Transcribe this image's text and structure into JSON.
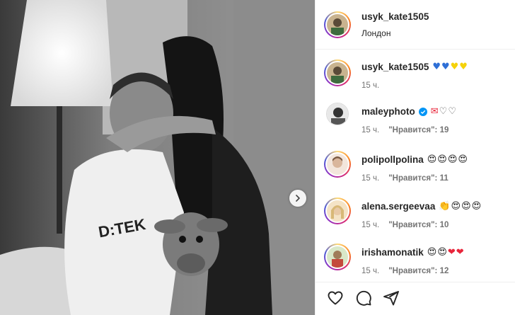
{
  "post": {
    "author": "usyk_kate1505",
    "location": "Лондон"
  },
  "comments": [
    {
      "user": "usyk_kate1505",
      "text": "💙💙💛💛",
      "time": "15 ч.",
      "likes": "",
      "verified": false
    },
    {
      "user": "maleyphoto",
      "text": "💌♡♡",
      "time": "15 ч.",
      "likes": "\"Нравится\": 19",
      "verified": true
    },
    {
      "user": "polipollpolina",
      "text": "😍😍😍😍",
      "time": "15 ч.",
      "likes": "\"Нравится\": 11",
      "verified": false
    },
    {
      "user": "alena.sergeevaa",
      "text": "👏😍😍😍",
      "time": "15 ч.",
      "likes": "\"Нравится\": 10",
      "verified": false
    },
    {
      "user": "irishamonatik",
      "text": "😍😍❤❤",
      "time": "15 ч.",
      "likes": "\"Нравится\": 12",
      "verified": false
    }
  ],
  "colors": {
    "verified": "#0095f6",
    "heart_blue": "#2e6fd6",
    "heart_yellow": "#f5d20a",
    "heart_red": "#e8253a"
  },
  "icons": {
    "like": "heart-outline-icon",
    "comment": "comment-bubble-icon",
    "share": "paper-plane-icon",
    "next": "chevron-right-icon"
  }
}
